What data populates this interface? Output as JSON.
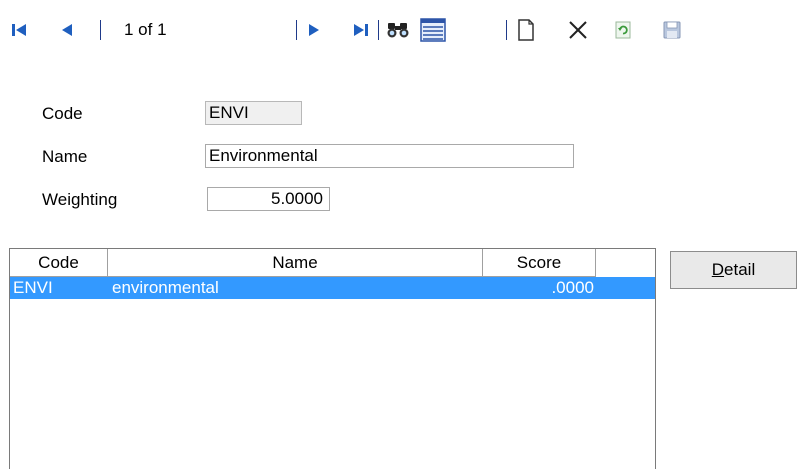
{
  "toolbar": {
    "record_counter": "1 of 1",
    "icons": [
      "first-record-icon",
      "previous-record-icon",
      "next-record-icon",
      "last-record-icon",
      "find-icon",
      "list-view-icon",
      "new-record-icon",
      "delete-icon",
      "refresh-icon",
      "save-icon"
    ]
  },
  "form": {
    "code_label": "Code",
    "code_value": "ENVI",
    "name_label": "Name",
    "name_value": "Environmental",
    "weighting_label": "Weighting",
    "weighting_value": "5.0000"
  },
  "grid": {
    "columns": [
      "Code",
      "Name",
      "Score"
    ],
    "rows": [
      {
        "code": "ENVI",
        "name": "environmental",
        "score": ".0000",
        "selected": true
      }
    ]
  },
  "buttons": {
    "detail_label_first": "D",
    "detail_label_rest": "etail"
  },
  "colors": {
    "selection": "#3399ff",
    "nav_icon": "#1f3a8a"
  }
}
